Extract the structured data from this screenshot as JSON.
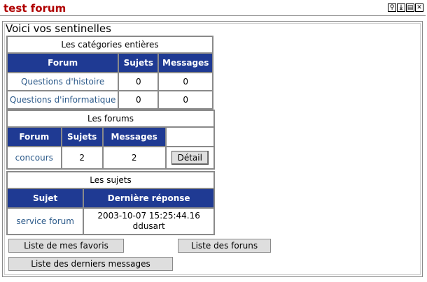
{
  "app": {
    "title": "test forum",
    "window_icons": [
      "zoom-icon",
      "download-icon",
      "restore-icon",
      "close-icon"
    ]
  },
  "panel": {
    "title": "Voici vos sentinelles"
  },
  "categories": {
    "caption": "Les catégories entières",
    "headers": [
      "Forum",
      "Sujets",
      "Messages"
    ],
    "rows": [
      {
        "forum": "Questions d'histoire",
        "sujets": "0",
        "messages": "0"
      },
      {
        "forum": "Questions d'informatique",
        "sujets": "0",
        "messages": "0"
      }
    ]
  },
  "forums": {
    "caption": "Les forums",
    "headers": [
      "Forum",
      "Sujets",
      "Messages"
    ],
    "rows": [
      {
        "forum": "concours",
        "sujets": "2",
        "messages": "2",
        "action": "Détail"
      }
    ]
  },
  "subjects": {
    "caption": "Les sujets",
    "headers": [
      "Sujet",
      "Dernière réponse"
    ],
    "rows": [
      {
        "sujet": "service forum",
        "date": "2003-10-07 15:25:44.16",
        "author": "ddusart"
      }
    ]
  },
  "buttons": {
    "favorites": "Liste de mes favoris",
    "forums_list": "Liste des foruns",
    "last_messages": "Liste des derniers messages"
  },
  "colors": {
    "header_bg": "#1f3a93",
    "title_red": "#b00000",
    "link": "#2c5a8a"
  }
}
